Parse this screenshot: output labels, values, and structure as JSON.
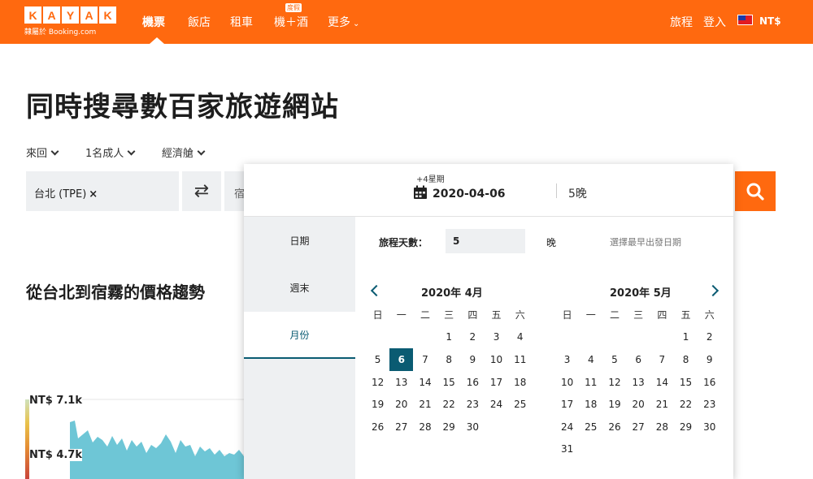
{
  "header": {
    "logo_letters": [
      "K",
      "A",
      "Y",
      "A",
      "K"
    ],
    "logo_sub": "隸屬於 Booking.com",
    "nav": [
      {
        "label": "機票",
        "active": true
      },
      {
        "label": "飯店"
      },
      {
        "label": "租車"
      },
      {
        "label": "機＋酒",
        "badge": "度假"
      },
      {
        "label": "更多"
      }
    ],
    "trips": "旅程",
    "login": "登入",
    "currency": "NT$"
  },
  "hero": {
    "title": "同時搜尋數百家旅遊網站",
    "filters": [
      "來回",
      "1名成人",
      "經濟艙"
    ],
    "origin": "台北 (TPE)",
    "origin_clear": "×",
    "swap": "⇄",
    "destination_partial": "宿"
  },
  "trend": {
    "title": "從台北到宿霧的價格趨勢",
    "label_high": "NT$ 7.1k",
    "label_mid": "NT$ 4.7k"
  },
  "popup": {
    "depart_sub": "+4星期",
    "depart_date": "2020-04-06",
    "nights": "5晚",
    "tabs": [
      {
        "label": "日期"
      },
      {
        "label": "週末"
      },
      {
        "label": "月份",
        "active": true
      }
    ],
    "duration_label": "旅程天數：",
    "duration_value": "5",
    "duration_unit": "晚",
    "duration_hint": "選擇最早出發日期",
    "weekdays": [
      "日",
      "一",
      "二",
      "三",
      "四",
      "五",
      "六"
    ],
    "months": [
      {
        "title": "2020年 4月",
        "offset": 3,
        "days": 30,
        "selected": 6
      },
      {
        "title": "2020年 5月",
        "offset": 5,
        "days": 31,
        "selected": null
      }
    ]
  },
  "colors": {
    "brand": "#ff690f",
    "accent": "#0a5b72",
    "chart": "#6ec6d6"
  }
}
